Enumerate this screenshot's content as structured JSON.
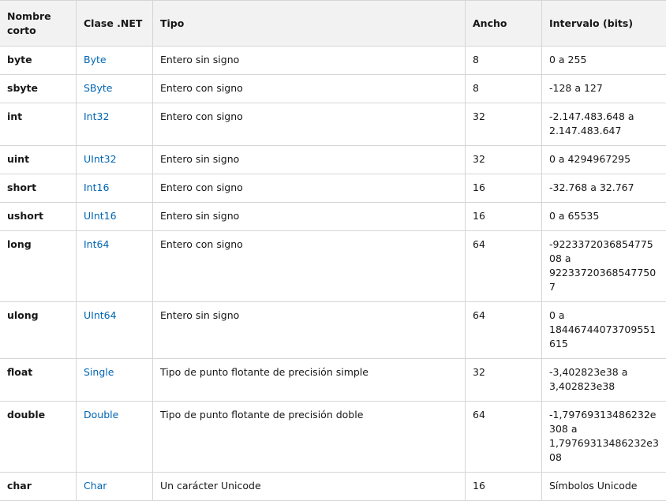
{
  "table": {
    "headers": {
      "short_name": "Nombre corto",
      "net_class": "Clase .NET",
      "type": "Tipo",
      "width": "Ancho",
      "range": "Intervalo (bits)"
    },
    "rows": [
      {
        "short": "byte",
        "net": "Byte",
        "type": "Entero sin signo",
        "width": "8",
        "range": "0 a 255"
      },
      {
        "short": "sbyte",
        "net": "SByte",
        "type": "Entero con signo",
        "width": "8",
        "range": "-128 a 127"
      },
      {
        "short": "int",
        "net": "Int32",
        "type": "Entero con signo",
        "width": "32",
        "range": "-2.147.483.648 a 2.147.483.647"
      },
      {
        "short": "uint",
        "net": "UInt32",
        "type": "Entero sin signo",
        "width": "32",
        "range": "0 a 4294967295"
      },
      {
        "short": "short",
        "net": "Int16",
        "type": "Entero con signo",
        "width": "16",
        "range": "-32.768 a 32.767"
      },
      {
        "short": "ushort",
        "net": "UInt16",
        "type": "Entero sin signo",
        "width": "16",
        "range": "0 a 65535"
      },
      {
        "short": "long",
        "net": "Int64",
        "type": "Entero con signo",
        "width": "64",
        "range": "-922337203685477508 a 922337203685477507"
      },
      {
        "short": "ulong",
        "net": "UInt64",
        "type": "Entero sin signo",
        "width": "64",
        "range": "0 a 18446744073709551615"
      },
      {
        "short": "float",
        "net": "Single",
        "type": "Tipo de punto flotante de precisión simple",
        "width": "32",
        "range": "-3,402823e38 a 3,402823e38"
      },
      {
        "short": "double",
        "net": "Double",
        "type": "Tipo de punto flotante de precisión doble",
        "width": "64",
        "range": "-1,79769313486232e308 a 1,79769313486232e308"
      },
      {
        "short": "char",
        "net": "Char",
        "type": "Un carácter Unicode",
        "width": "16",
        "range": "Símbolos Unicode"
      }
    ]
  },
  "colors": {
    "link": "#0065b3",
    "header_bg": "#f2f2f2",
    "border": "#d6d6d6"
  }
}
